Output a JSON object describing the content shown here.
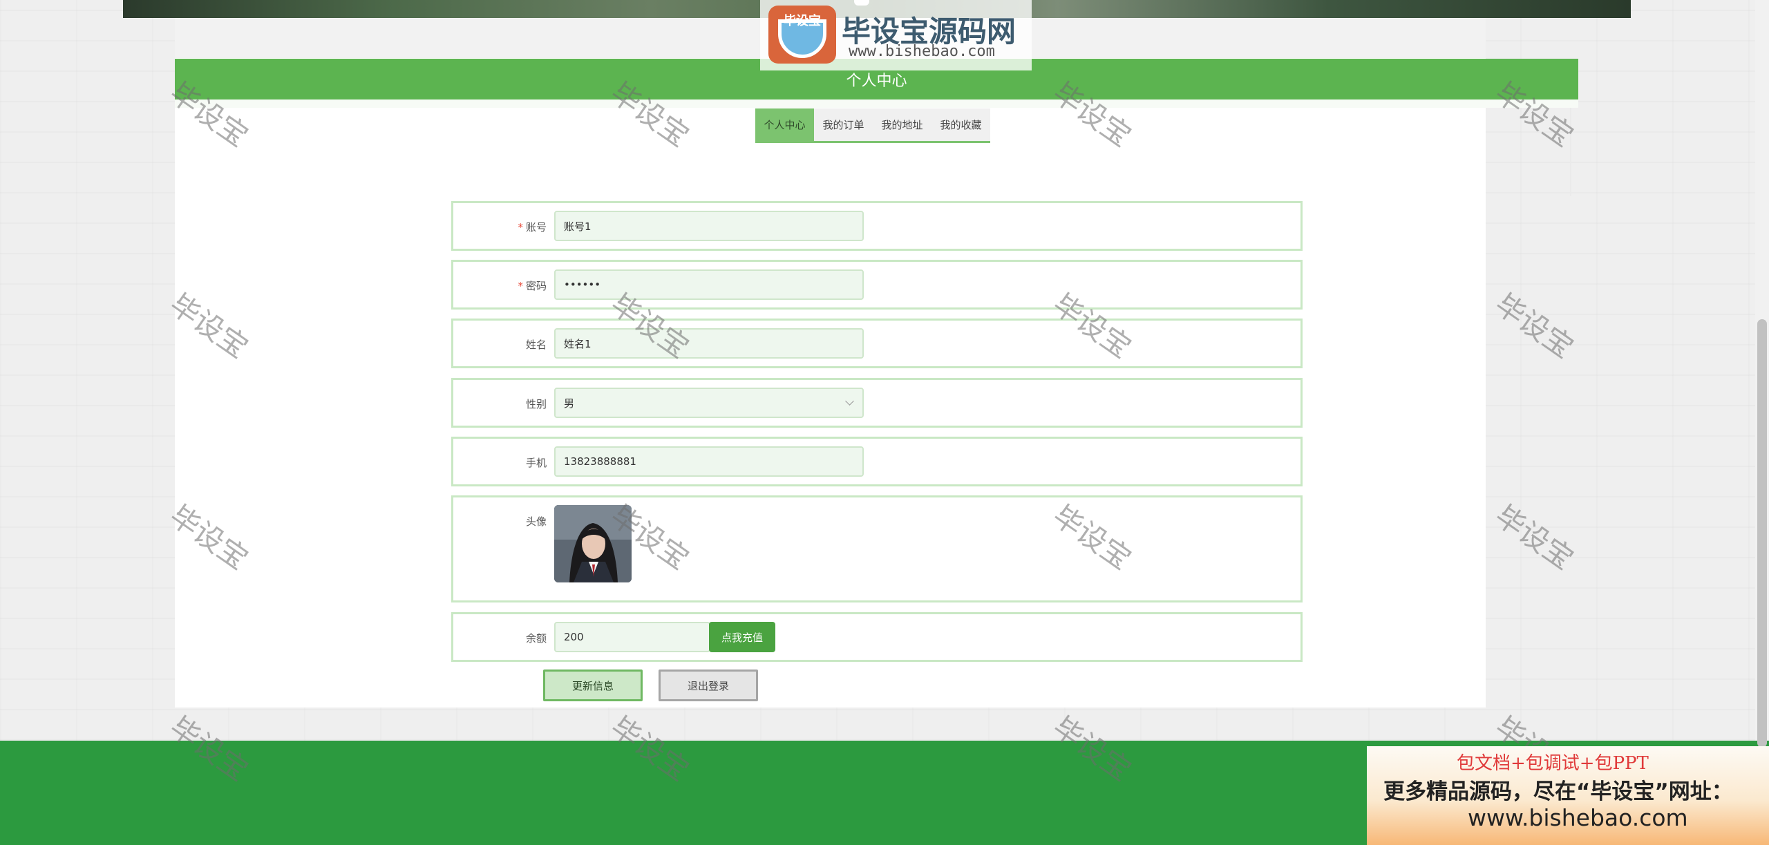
{
  "page": {
    "title": "个人中心"
  },
  "tabs": [
    {
      "label": "个人中心",
      "active": true
    },
    {
      "label": "我的订单",
      "active": false
    },
    {
      "label": "我的地址",
      "active": false
    },
    {
      "label": "我的收藏",
      "active": false
    }
  ],
  "form": {
    "account": {
      "label": "账号",
      "required": true,
      "value": "账号1"
    },
    "password": {
      "label": "密码",
      "required": true,
      "value": "••••••"
    },
    "name": {
      "label": "姓名",
      "required": false,
      "value": "姓名1"
    },
    "gender": {
      "label": "性别",
      "required": false,
      "value": "男"
    },
    "phone": {
      "label": "手机",
      "required": false,
      "value": "13823888881"
    },
    "avatar": {
      "label": "头像"
    },
    "balance": {
      "label": "余额",
      "value": "200",
      "recharge_label": "点我充值"
    }
  },
  "actions": {
    "update_label": "更新信息",
    "logout_label": "退出登录"
  },
  "watermark": {
    "text": "毕设宝",
    "logo_title": "毕设宝源码网",
    "logo_url": "www.bishebao.com",
    "logo_badge": "毕设宝"
  },
  "promo": {
    "line1": "包文档+包调试+包PPT",
    "line2": "更多精品源码，尽在“毕设宝”网址：",
    "line3": "www.bishebao.com"
  },
  "colors": {
    "primary_green": "#5cb450",
    "footer_green": "#2c9a3f",
    "required_red": "#e74c3c"
  }
}
